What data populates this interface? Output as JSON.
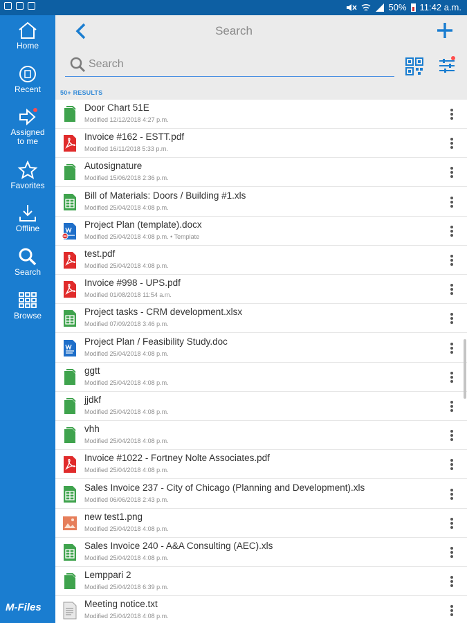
{
  "status_bar": {
    "battery": "50%",
    "time": "11:42 a.m."
  },
  "sidebar": {
    "items": [
      {
        "label": "Home",
        "icon": "home-icon"
      },
      {
        "label": "Recent",
        "icon": "recent-icon"
      },
      {
        "label": "Assigned to me",
        "icon": "assigned-icon"
      },
      {
        "label": "Favorites",
        "icon": "star-icon"
      },
      {
        "label": "Offline",
        "icon": "download-icon"
      },
      {
        "label": "Search",
        "icon": "search-icon"
      },
      {
        "label": "Browse",
        "icon": "grid-icon"
      }
    ],
    "logo": "M-Files"
  },
  "header": {
    "title": "Search",
    "search_placeholder": "Search",
    "results_count": "50+ RESULTS"
  },
  "colors": {
    "sidebar": "#1a7dd0",
    "status_bar": "#0d5fa3",
    "accent": "#1a7dd0",
    "pdf": "#e02b2b",
    "sheet": "#3fa34d",
    "doc": "#1f6fc9"
  },
  "files": [
    {
      "name": "Door Chart 51E",
      "meta": "Modified 12/12/2018 4:27 p.m.",
      "type": "document"
    },
    {
      "name": "Invoice #162 - ESTT.pdf",
      "meta": "Modified 16/11/2018 5:33 p.m.",
      "type": "pdf"
    },
    {
      "name": "Autosignature",
      "meta": "Modified 15/06/2018 2:36 p.m.",
      "type": "document"
    },
    {
      "name": "Bill of Materials: Doors / Building #1.xls",
      "meta": "Modified 25/04/2018 4:08 p.m.",
      "type": "spreadsheet"
    },
    {
      "name": "Project Plan (template).docx",
      "meta": "Modified 25/04/2018 4:08 p.m. • Template",
      "type": "word-template"
    },
    {
      "name": "test.pdf",
      "meta": "Modified 25/04/2018 4:08 p.m.",
      "type": "pdf"
    },
    {
      "name": "Invoice #998 - UPS.pdf",
      "meta": "Modified 01/08/2018 11:54 a.m.",
      "type": "pdf"
    },
    {
      "name": "Project tasks - CRM development.xlsx",
      "meta": "Modified 07/09/2018 3:46 p.m.",
      "type": "spreadsheet"
    },
    {
      "name": "Project Plan / Feasibility Study.doc",
      "meta": "Modified 25/04/2018 4:08 p.m.",
      "type": "word"
    },
    {
      "name": "ggtt",
      "meta": "Modified 25/04/2018 4:08 p.m.",
      "type": "document"
    },
    {
      "name": "jjdkf",
      "meta": "Modified 25/04/2018 4:08 p.m.",
      "type": "document"
    },
    {
      "name": "vhh",
      "meta": "Modified 25/04/2018 4:08 p.m.",
      "type": "document"
    },
    {
      "name": "Invoice #1022 - Fortney Nolte Associates.pdf",
      "meta": "Modified 25/04/2018 4:08 p.m.",
      "type": "pdf"
    },
    {
      "name": "Sales Invoice 237 - City of Chicago (Planning and Development).xls",
      "meta": "Modified 06/06/2018 2:43 p.m.",
      "type": "spreadsheet"
    },
    {
      "name": "new test1.png",
      "meta": "Modified 25/04/2018 4:08 p.m.",
      "type": "image"
    },
    {
      "name": "Sales Invoice 240 - A&A Consulting (AEC).xls",
      "meta": "Modified 25/04/2018 4:08 p.m.",
      "type": "spreadsheet"
    },
    {
      "name": "Lemppari 2",
      "meta": "Modified 25/04/2018 6:39 p.m.",
      "type": "document"
    },
    {
      "name": "Meeting notice.txt",
      "meta": "Modified 25/04/2018 4:08 p.m.",
      "type": "text"
    }
  ]
}
